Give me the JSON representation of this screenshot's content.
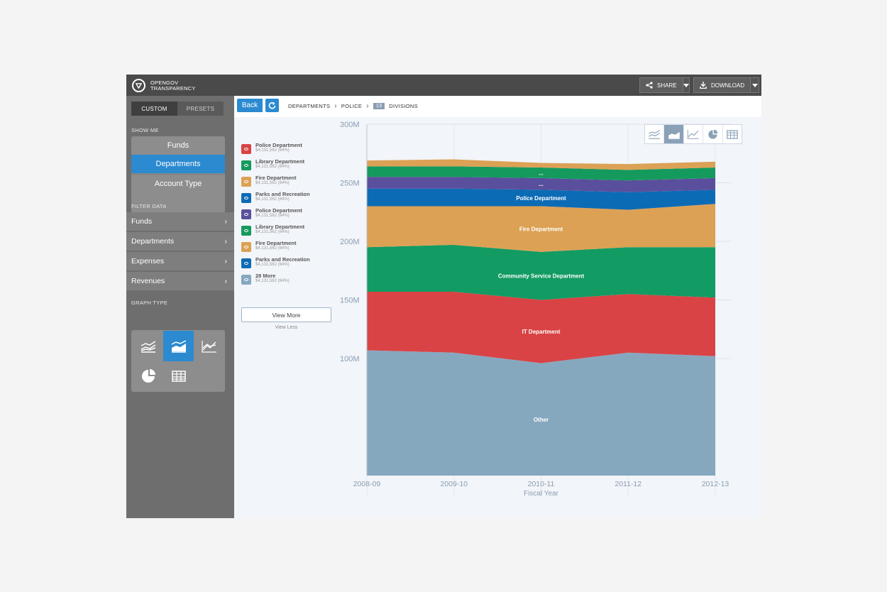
{
  "header": {
    "brand_line1": "OPENGOV",
    "brand_line2": "TRANSPARENCY",
    "share_label": "SHARE",
    "download_label": "DOWNLOAD"
  },
  "sidebar": {
    "tabs": [
      {
        "label": "CUSTOM",
        "active": true
      },
      {
        "label": "PRESETS",
        "active": false
      }
    ],
    "show_me_heading": "SHOW ME",
    "show_me": [
      {
        "label": "Funds",
        "active": false
      },
      {
        "label": "Departments",
        "active": true
      },
      {
        "label": "Account Type",
        "active": false
      }
    ],
    "filter_heading": "FILTER DATA",
    "filters": [
      {
        "label": "Funds"
      },
      {
        "label": "Departments"
      },
      {
        "label": "Expenses"
      },
      {
        "label": "Revenues"
      }
    ],
    "graph_type_heading": "GRAPH TYPE",
    "graph_types": [
      {
        "icon": "stacked-lines-icon",
        "active": false
      },
      {
        "icon": "stacked-area-icon",
        "active": true
      },
      {
        "icon": "line-chart-icon",
        "active": false
      },
      {
        "icon": "pie-chart-icon",
        "active": false
      },
      {
        "icon": "table-icon",
        "active": false
      }
    ]
  },
  "toolbar": {
    "back_label": "Back",
    "breadcrumb": [
      "DEPARTMENTS",
      "POLICE"
    ],
    "division_count": "13",
    "divisions_label": "DIVISIONS"
  },
  "legend": {
    "items": [
      {
        "name": "Police Department",
        "value": "$4,131,562 (64%)",
        "color": "#d94345"
      },
      {
        "name": "Library Department",
        "value": "$4,131,562 (64%)",
        "color": "#159a5e"
      },
      {
        "name": "Fire Department",
        "value": "$4,131,562 (64%)",
        "color": "#dca155"
      },
      {
        "name": "Parks and Recreation",
        "value": "$4,131,562 (64%)",
        "color": "#0c6bb5"
      },
      {
        "name": "Police Department",
        "value": "$4,131,562 (64%)",
        "color": "#5a4f9d"
      },
      {
        "name": "Library Department",
        "value": "$4,131,562 (64%)",
        "color": "#159a5e"
      },
      {
        "name": "Fire Department",
        "value": "$4,131,562 (64%)",
        "color": "#dca155"
      },
      {
        "name": "Parks and Recreation",
        "value": "$4,131,562 (64%)",
        "color": "#0c6bb5"
      },
      {
        "name": "28 More",
        "value": "$4,131,562 (64%)",
        "color": "#86a8bf"
      }
    ],
    "view_more": "View More",
    "view_less": "View Less"
  },
  "chart_data": {
    "type": "area",
    "stacked": true,
    "x": [
      "2008-09",
      "2009-10",
      "2010-11",
      "2011-12",
      "2012-13"
    ],
    "xlabel": "Fiscal Year",
    "ylabel": "",
    "ylim": [
      0,
      300
    ],
    "yticks": [
      "100M",
      "150M",
      "200M",
      "250M",
      "300M"
    ],
    "ytick_values": [
      100,
      150,
      200,
      250,
      300
    ],
    "series": [
      {
        "name": "Other",
        "color": "#86a8bf",
        "values": [
          107,
          105,
          96,
          105,
          102
        ]
      },
      {
        "name": "IT Department",
        "color": "#d94345",
        "values": [
          50,
          52,
          54,
          50,
          50
        ]
      },
      {
        "name": "Community Service Department",
        "color": "#129b63",
        "values": [
          38,
          40,
          41,
          40,
          43
        ]
      },
      {
        "name": "Fire Department",
        "color": "#dca155",
        "values": [
          35,
          33,
          39,
          32,
          37
        ]
      },
      {
        "name": "Police Department",
        "color": "#0c6bb5",
        "values": [
          15,
          15,
          14,
          15,
          12
        ]
      },
      {
        "name": "...",
        "color": "#5a4f9d",
        "values": [
          10,
          10,
          10,
          10,
          10
        ]
      },
      {
        "name": "...",
        "color": "#159a5e",
        "values": [
          9,
          9,
          9,
          9,
          9
        ]
      },
      {
        "name": "",
        "color": "#dca155",
        "values": [
          5,
          6,
          4,
          5,
          5
        ]
      }
    ],
    "legend_position": "left",
    "grid": true
  }
}
